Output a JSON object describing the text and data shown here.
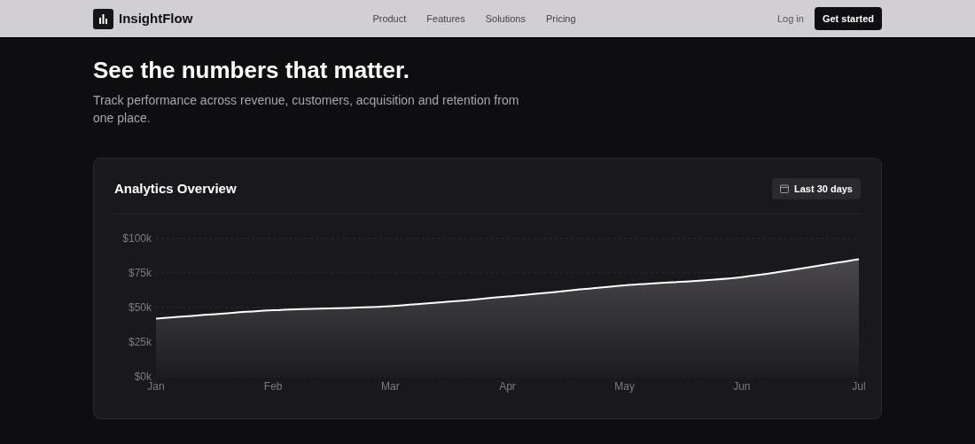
{
  "nav": {
    "brand": "InsightFlow",
    "links": [
      "Product",
      "Features",
      "Solutions",
      "Pricing"
    ],
    "login": "Log in",
    "cta": "Get started"
  },
  "hero": {
    "title": "See the numbers that matter.",
    "subtitle": "Track performance across revenue, customers, acquisition and retention from one place."
  },
  "card": {
    "title": "Analytics Overview",
    "range_button": "Last 30 days",
    "chart_data": {
      "type": "area",
      "categories": [
        "Jan",
        "Feb",
        "Mar",
        "Apr",
        "May",
        "Jun",
        "Jul"
      ],
      "series": [
        {
          "color": "#ffffff",
          "values": [
            42000,
            48000,
            51000,
            58000,
            66000,
            72000,
            85000
          ]
        }
      ],
      "ylim": [
        0,
        100000
      ],
      "yticks": [
        {
          "value": 0,
          "label": "$0k"
        },
        {
          "value": 25000,
          "label": "$25k"
        },
        {
          "value": 50000,
          "label": "$50k"
        },
        {
          "value": 75000,
          "label": "$75k"
        },
        {
          "value": 100000,
          "label": "$100k"
        }
      ]
    }
  }
}
